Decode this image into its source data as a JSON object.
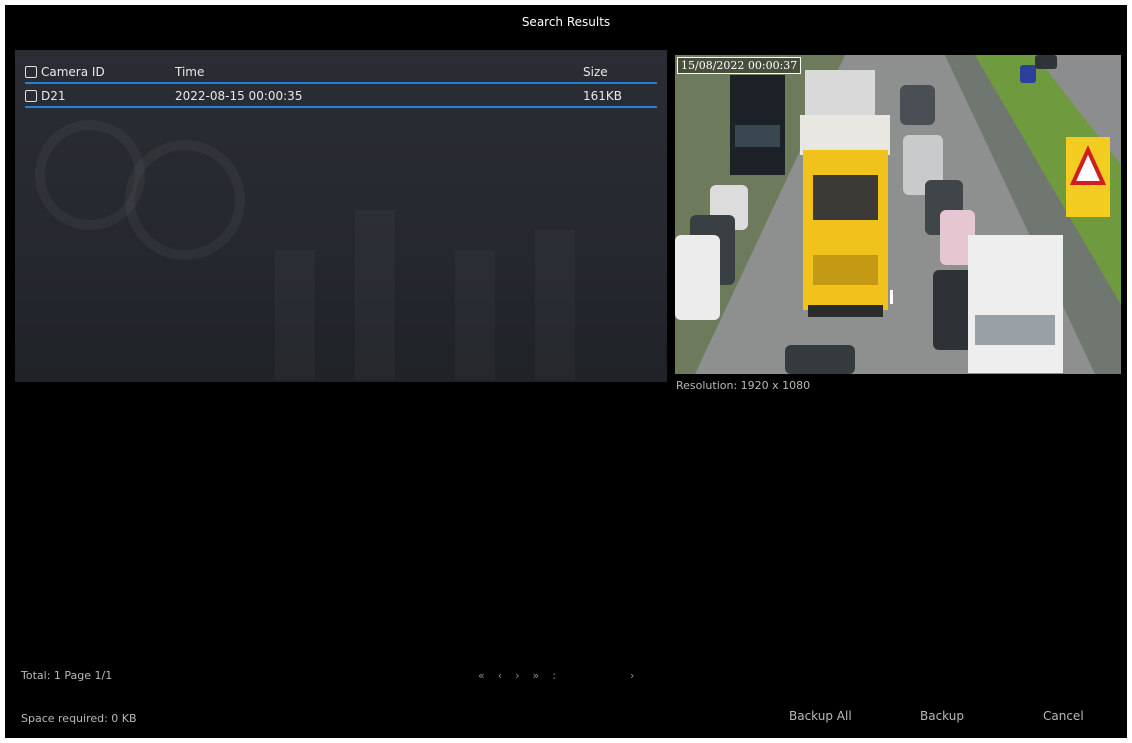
{
  "window": {
    "title": "Search Results"
  },
  "table": {
    "columns": {
      "id": "Camera ID",
      "time": "Time",
      "size": "Size"
    },
    "rows": [
      {
        "id": "D21",
        "time": "2022-08-15 00:00:35",
        "size": "161KB"
      }
    ]
  },
  "preview": {
    "timestamp": "15/08/2022 00:00:37",
    "resolution": "Resolution: 1920 x 1080"
  },
  "footer": {
    "total": "Total: 1  Page 1/1",
    "pager": {
      "first": "«",
      "prev": "‹",
      "next": "›",
      "last": "»",
      "page_sep": ":",
      "go": "›"
    },
    "space": "Space required: 0 KB",
    "backup_all": "Backup All",
    "backup": "Backup",
    "cancel": "Cancel"
  },
  "colors": {
    "accent": "#2d7fd1",
    "background": "#000000",
    "panel": "#26292f"
  },
  "icons": {
    "checkbox": "checkbox-icon",
    "warning_sign": "warning-sign-icon"
  }
}
